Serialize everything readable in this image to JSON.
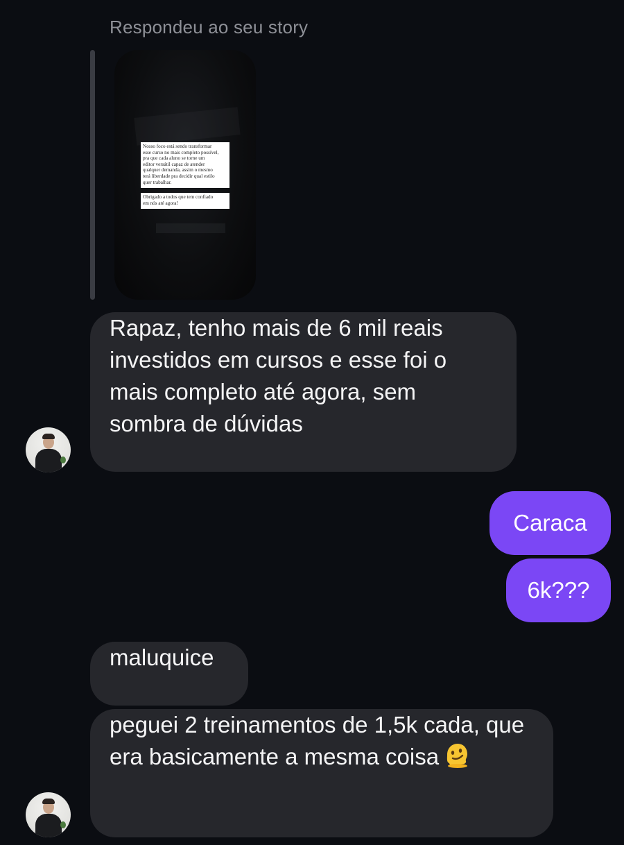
{
  "reply_header": "Respondeu ao seu story",
  "story": {
    "text_block_1": "Nosso foco está sendo transformar\nesse curso no mais completo possível,\npra que cada aluno se torne um\neditor versátil capaz de atender\nqualquer demanda, assim o mesmo\nterá liberdade pra decidir qual estilo\nquer trabalhar.",
    "text_block_2": "Obrigado a todos que tem confiado\nem nós até agora!"
  },
  "messages": [
    {
      "direction": "incoming",
      "text": "Rapaz, tenho mais de 6 mil reais investidos em cursos e esse foi o mais completo até agora, sem sombra de dúvidas"
    },
    {
      "direction": "outgoing",
      "text": "Caraca"
    },
    {
      "direction": "outgoing",
      "text": "6k???"
    },
    {
      "direction": "incoming",
      "text": "maluquice"
    },
    {
      "direction": "incoming",
      "text": "peguei 2 treinamentos de 1,5k cada, que era basicamente a mesma coisa",
      "emoji": "melting-face-emoji"
    }
  ],
  "colors": {
    "background": "#0b0d12",
    "incoming_bubble": "#26272c",
    "outgoing_bubble": "#7b47f5",
    "secondary_text": "#8e9097"
  }
}
